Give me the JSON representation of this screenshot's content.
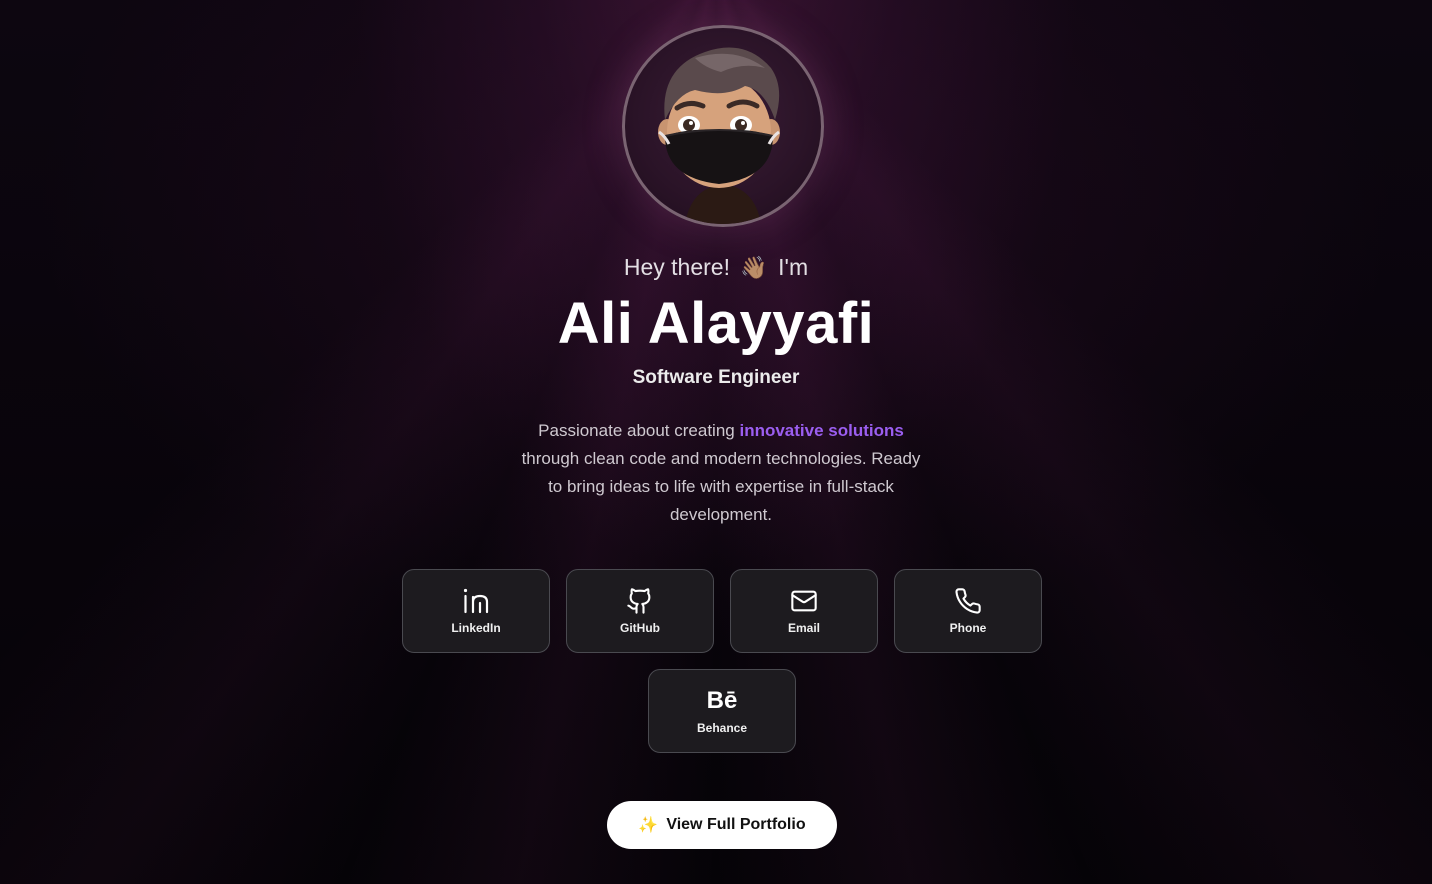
{
  "profile": {
    "greeting_prefix": "Hey there!",
    "greeting_emoji": "👋🏽",
    "greeting_suffix": "I'm",
    "name": "Ali Alayyafi",
    "role": "Software Engineer",
    "bio_before": "Passionate about creating ",
    "bio_highlight": "innovative solutions",
    "bio_after": " through clean code and modern technologies. Ready to bring ideas to life with expertise in full-stack development.",
    "avatar_icon": "memoji-avatar-with-mask"
  },
  "social_links": [
    {
      "label": "LinkedIn",
      "icon": "linkedin-icon"
    },
    {
      "label": "GitHub",
      "icon": "github-icon"
    },
    {
      "label": "Email",
      "icon": "mail-icon"
    },
    {
      "label": "Phone",
      "icon": "phone-icon"
    },
    {
      "label": "Behance",
      "icon": "behance-icon",
      "glyph": "Bē"
    }
  ],
  "cta": {
    "label": "View Full Portfolio",
    "icon": "sparkles-icon",
    "glyph": "✨"
  },
  "colors": {
    "accent": "#9b5ef0",
    "card_bg": "#1d1b1f",
    "card_border": "#4a4a50",
    "background": "#07050a"
  }
}
